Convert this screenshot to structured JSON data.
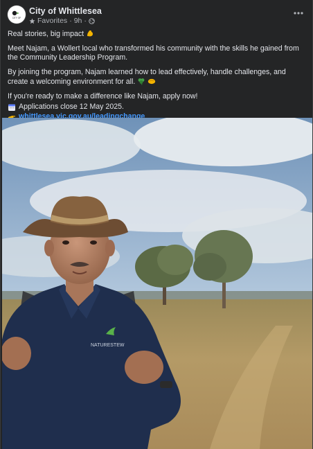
{
  "post": {
    "page_name": "City of Whittlesea",
    "audience": "Favorites",
    "time": "9h",
    "headline": "Real stories, big impact",
    "paragraph1": "Meet Najam, a Wollert local who transformed his community with the skills he gained from the Community Leadership Program.",
    "paragraph2": "By joining the program, Najam learned how to lead effectively, handle challenges, and create a welcoming environment for all.",
    "paragraph3": "If you're ready to make a difference like Najam, apply now!",
    "deadline": "Applications close 12 May 2025.",
    "link": "whittlesea.vic.gov.au/leadingchange"
  },
  "icons": {
    "avatar": "city-of-whittlesea-logo",
    "favorites": "star-icon",
    "privacy": "globe-icon",
    "more": "more-options-icon",
    "headline_emoji": "flexed-biceps-emoji",
    "paragraph2_emoji": [
      "clover-emoji",
      "handshake-emoji"
    ],
    "deadline_emoji": "calendar-emoji",
    "link_emoji": "pointing-hand-emoji"
  },
  "photo": {
    "shirt_logo_text": "NATURESTEW",
    "description_colors": {
      "sky": "#a9c3dc",
      "field": "#b89a62",
      "shirt": "#1f2e4d",
      "hat": "#7a5a3c"
    }
  },
  "colors": {
    "background": "#242526",
    "text": "#e4e6eb",
    "secondary_text": "#b0b3b8",
    "link": "#4599ff"
  }
}
